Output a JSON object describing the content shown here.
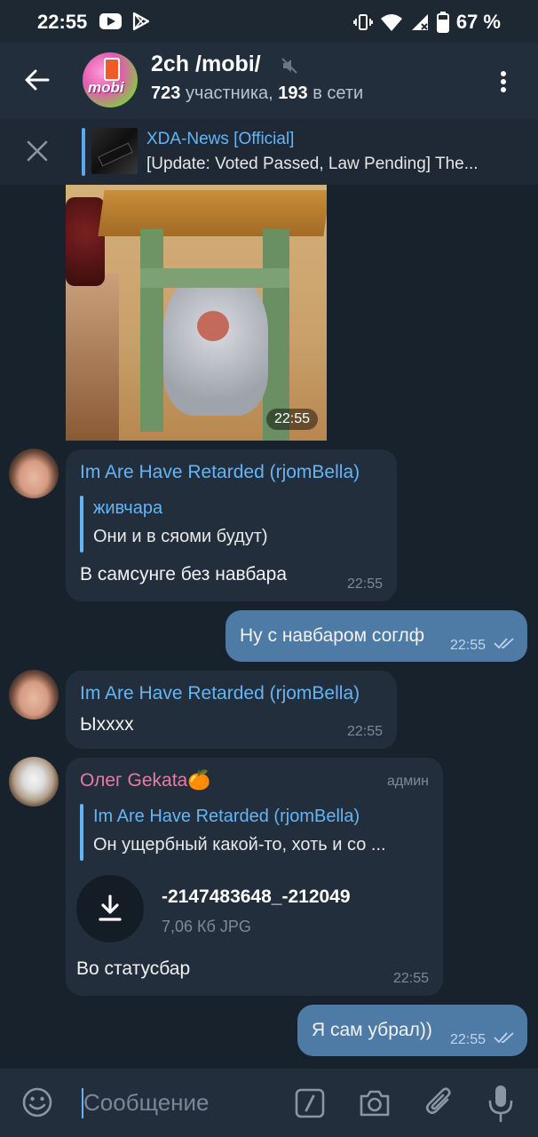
{
  "status_bar": {
    "time": "22:55",
    "battery_percent": "67 %",
    "icons": [
      "youtube-icon",
      "play-store-icon",
      "vibrate-icon",
      "wifi-icon",
      "signal-icon",
      "battery-icon"
    ]
  },
  "header": {
    "title": "2ch /mobi/",
    "avatar_text": "mobi",
    "subtitle_members": "723",
    "subtitle_members_label": "участника,",
    "subtitle_online": "193",
    "subtitle_online_label": "в сети",
    "muted": true
  },
  "pinned": {
    "title": "XDA-News [Official]",
    "text": "[Update: Voted Passed, Law Pending] The..."
  },
  "messages": {
    "photo": {
      "time": "22:55"
    },
    "m1": {
      "sender": "Im Are Have Retarded (rjomBella)",
      "reply_name": "живчара",
      "reply_text": "Они и в сяоми будут)",
      "text": "В самсунге без навбара",
      "time": "22:55"
    },
    "m2": {
      "text": "Ну с навбаром соглф",
      "time": "22:55"
    },
    "m3": {
      "sender": "Im Are Have Retarded (rjomBella)",
      "text": "Ыхххх",
      "time": "22:55"
    },
    "m4": {
      "sender": "Олег Gekata🍊",
      "role": "админ",
      "reply_name": "Im Are Have Retarded (rjomBella)",
      "reply_text": "Он ущербный какой-то, хоть и со ...",
      "file_name": "-2147483648_-212049",
      "file_meta": "7,06 Кб JPG",
      "text": "Во статусбар",
      "time": "22:55"
    },
    "m5": {
      "text": "Я сам убрал))",
      "time": "22:55"
    }
  },
  "composer": {
    "placeholder": "Сообщение"
  },
  "colors": {
    "background": "#18222d",
    "header": "#232e3c",
    "incoming_bubble": "#232e3c",
    "outgoing_bubble": "#4d7ba6",
    "accent": "#64b5f6",
    "admin_name": "#e57ca3"
  }
}
